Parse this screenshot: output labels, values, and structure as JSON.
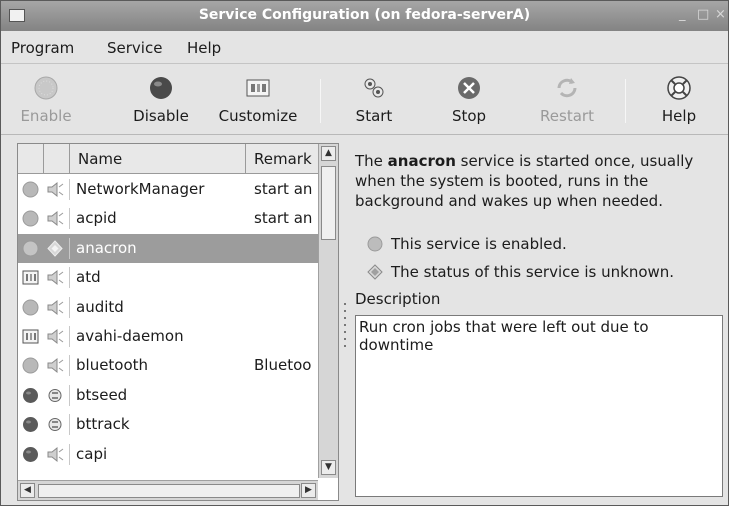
{
  "window": {
    "title": "Service Configuration (on fedora-serverA)",
    "controls": {
      "minimize": "_",
      "maximize": "□",
      "close": "×"
    }
  },
  "menubar": {
    "items": [
      "Program",
      "Service",
      "Help"
    ]
  },
  "toolbar": {
    "enable": "Enable",
    "disable": "Disable",
    "customize": "Customize",
    "start": "Start",
    "stop": "Stop",
    "restart": "Restart",
    "help": "Help"
  },
  "service_list": {
    "columns": [
      "Name",
      "Remark"
    ],
    "rows": [
      {
        "name": "NetworkManager",
        "remark": "start an",
        "state": "enabled-grey",
        "runtime": "speaker",
        "selected": false
      },
      {
        "name": "acpid",
        "remark": "start an",
        "state": "enabled-grey",
        "runtime": "speaker",
        "selected": false
      },
      {
        "name": "anacron",
        "remark": "",
        "state": "enabled-grey",
        "runtime": "diamond",
        "selected": true
      },
      {
        "name": "atd",
        "remark": "",
        "state": "custom",
        "runtime": "speaker",
        "selected": false
      },
      {
        "name": "auditd",
        "remark": "",
        "state": "enabled-grey",
        "runtime": "speaker",
        "selected": false
      },
      {
        "name": "avahi-daemon",
        "remark": "",
        "state": "custom",
        "runtime": "speaker",
        "selected": false
      },
      {
        "name": "bluetooth",
        "remark": "Bluetoo",
        "state": "enabled-grey",
        "runtime": "speaker",
        "selected": false
      },
      {
        "name": "btseed",
        "remark": "",
        "state": "disabled-dark",
        "runtime": "plug",
        "selected": false
      },
      {
        "name": "bttrack",
        "remark": "",
        "state": "disabled-dark",
        "runtime": "plug",
        "selected": false
      },
      {
        "name": "capi",
        "remark": "",
        "state": "disabled-dark",
        "runtime": "speaker",
        "selected": false
      }
    ]
  },
  "details": {
    "intro_prefix": "The ",
    "service_name": "anacron",
    "intro_suffix": " service is started once, usually when the system is booted, runs in the background and wakes up when needed.",
    "enabled_status": "This service is enabled.",
    "run_status": "The status of this service is unknown.",
    "description_label": "Description",
    "description_text": "Run cron jobs that were left out due to downtime"
  },
  "colors": {
    "titlebar": "#8f8f8f",
    "selection": "#9c9c9c",
    "enabled_dot": "#b8b8b8",
    "disabled_dot": "#5a5a5a"
  }
}
